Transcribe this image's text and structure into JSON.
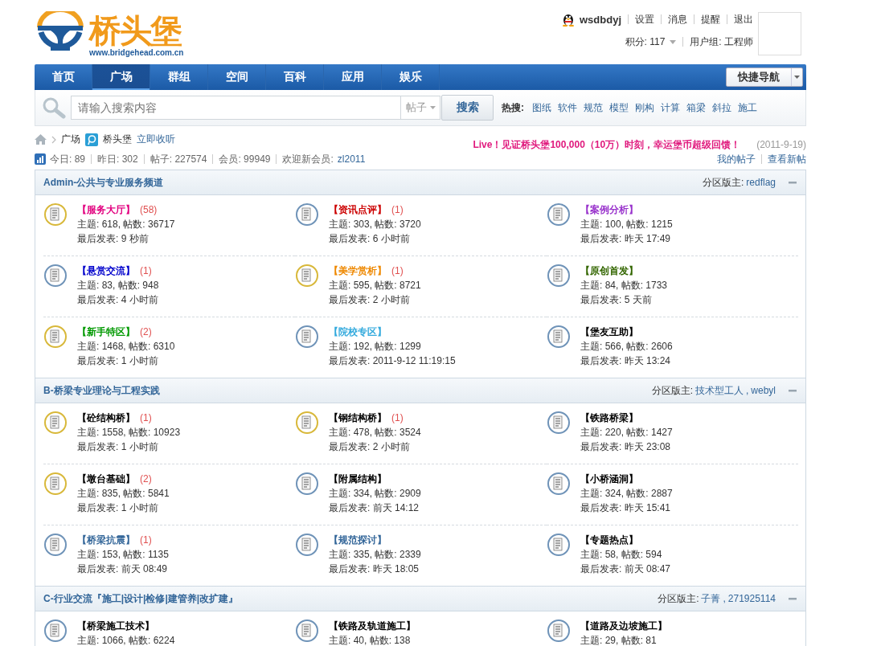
{
  "header": {
    "logo_text": "桥头堡",
    "logo_url": "www.bridgehead.com.cn",
    "user": {
      "name": "wsdbdyj",
      "links": [
        "设置",
        "消息",
        "提醒",
        "退出"
      ],
      "points": "积分: 117",
      "group": "用户组: 工程师"
    }
  },
  "nav": {
    "items": [
      {
        "label": "首页",
        "selected": false
      },
      {
        "label": "广场",
        "selected": true
      },
      {
        "label": "群组",
        "selected": false
      },
      {
        "label": "空间",
        "selected": false
      },
      {
        "label": "百科",
        "selected": false
      },
      {
        "label": "应用",
        "selected": false
      },
      {
        "label": "娱乐",
        "selected": false
      }
    ],
    "quick_nav": "快捷导航"
  },
  "search": {
    "placeholder": "请输入搜索内容",
    "scope": "帖子",
    "button": "搜索",
    "hot_label": "热搜:",
    "hot": [
      "图纸",
      "软件",
      "规范",
      "模型",
      "刚构",
      "计算",
      "箱梁",
      "斜拉",
      "施工"
    ]
  },
  "breadcrumb": {
    "items": [
      "广场"
    ],
    "follow_name": "桥头堡",
    "follow_link": "立即收听"
  },
  "announcements": [
    {
      "text": "Live！见证桥头堡100,000（10万）时刻，幸运堡币超级回馈！",
      "date": "(2011-9-19)"
    }
  ],
  "stats": [
    "今日: 89",
    "昨日: 302",
    "帖子: 227574",
    "会员: 99949"
  ],
  "welcome": {
    "label": "欢迎新会员:",
    "member": "zl2011"
  },
  "my_links": [
    "我的帖子",
    "查看新帖"
  ],
  "sections": [
    {
      "title": "Admin-公共与专业服务频道",
      "moderator_label": "分区版主:",
      "moderators": [
        "redflag"
      ],
      "expanded": true,
      "forums": [
        {
          "name": "【服务大厅】",
          "color": "#e2007f",
          "new_count": "(58)",
          "has_new": true,
          "stats": "主题: 618, 帖数: 36717",
          "last_post": "最后发表: 9 秒前"
        },
        {
          "name": "【资讯点评】",
          "color": "#cc0000",
          "new_count": "(1)",
          "has_new": false,
          "stats": "主题: 303, 帖数: 3720",
          "last_post": "最后发表: 6 小时前"
        },
        {
          "name": "【案例分析】",
          "color": "#9933cc",
          "has_new": false,
          "stats": "主题: 100, 帖数: 1215",
          "last_post": "最后发表: 昨天 17:49"
        },
        {
          "name": "【悬赏交流】",
          "color": "#0000cc",
          "new_count": "(1)",
          "has_new": false,
          "stats": "主题: 83, 帖数: 948",
          "last_post": "最后发表: 4 小时前"
        },
        {
          "name": "【美学赏析】",
          "color": "#ee8800",
          "new_count": "(1)",
          "has_new": true,
          "stats": "主题: 595, 帖数: 8721",
          "last_post": "最后发表: 2 小时前"
        },
        {
          "name": "【原创首发】",
          "color": "#336600",
          "has_new": false,
          "stats": "主题: 84, 帖数: 1733",
          "last_post": "最后发表: 5 天前"
        },
        {
          "name": "【新手特区】",
          "color": "#009900",
          "new_count": "(2)",
          "has_new": true,
          "stats": "主题: 1468, 帖数: 6310",
          "last_post": "最后发表: 1 小时前"
        },
        {
          "name": "【院校专区】",
          "color": "#33aadd",
          "has_new": false,
          "stats": "主题: 192, 帖数: 1299",
          "last_post": "最后发表: 2011-9-12 11:19:15"
        },
        {
          "name": "【堡友互助】",
          "color": "#000000",
          "has_new": false,
          "stats": "主题: 566, 帖数: 2606",
          "last_post": "最后发表: 昨天 13:24"
        }
      ]
    },
    {
      "title": "B-桥梁专业理论与工程实践",
      "moderator_label": "分区版主:",
      "moderators": [
        "技术型工人",
        "webyl"
      ],
      "moderator_separator": ",",
      "expanded": true,
      "forums": [
        {
          "name": "【砼结构桥】",
          "color": "#000000",
          "new_count": "(1)",
          "has_new": true,
          "stats": "主题: 1558, 帖数: 10923",
          "last_post": "最后发表: 1 小时前"
        },
        {
          "name": "【钢结构桥】",
          "color": "#000000",
          "new_count": "(1)",
          "has_new": true,
          "stats": "主题: 478, 帖数: 3524",
          "last_post": "最后发表: 2 小时前"
        },
        {
          "name": "【铁路桥梁】",
          "color": "#000000",
          "has_new": false,
          "stats": "主题: 220, 帖数: 1427",
          "last_post": "最后发表: 昨天 23:08"
        },
        {
          "name": "【墩台基础】",
          "color": "#000000",
          "new_count": "(2)",
          "has_new": true,
          "stats": "主题: 835, 帖数: 5841",
          "last_post": "最后发表: 1 小时前"
        },
        {
          "name": "【附属结构】",
          "color": "#000000",
          "has_new": false,
          "stats": "主题: 334, 帖数: 2909",
          "last_post": "最后发表: 前天 14:12"
        },
        {
          "name": "【小桥涵洞】",
          "color": "#000000",
          "has_new": false,
          "stats": "主题: 324, 帖数: 2887",
          "last_post": "最后发表: 昨天 15:41"
        },
        {
          "name": "【桥梁抗震】",
          "color": "#336699",
          "new_count": "(1)",
          "has_new": false,
          "stats": "主题: 153, 帖数: 1135",
          "last_post": "最后发表: 前天 08:49"
        },
        {
          "name": "【规范探讨】",
          "color": "#336699",
          "has_new": false,
          "stats": "主题: 335, 帖数: 2339",
          "last_post": "最后发表: 昨天 18:05"
        },
        {
          "name": "【专题热点】",
          "color": "#000000",
          "has_new": false,
          "stats": "主题: 58, 帖数: 594",
          "last_post": "最后发表: 前天 08:47"
        }
      ]
    },
    {
      "title": "C-行业交流『施工|设计|检修|建管养|改扩建』",
      "moderator_label": "分区版主:",
      "moderators": [
        "子菁",
        "271925114"
      ],
      "moderator_separator": ",",
      "expanded": true,
      "forums": [
        {
          "name": "【桥梁施工技术】",
          "color": "#000000",
          "has_new": false,
          "stats": "主题: 1066, 帖数: 6224"
        },
        {
          "name": "【铁路及轨道施工】",
          "color": "#000000",
          "has_new": false,
          "stats": "主题: 40, 帖数: 138"
        },
        {
          "name": "【道路及边坡施工】",
          "color": "#000000",
          "has_new": false,
          "stats": "主题: 29, 帖数: 81"
        }
      ]
    }
  ]
}
